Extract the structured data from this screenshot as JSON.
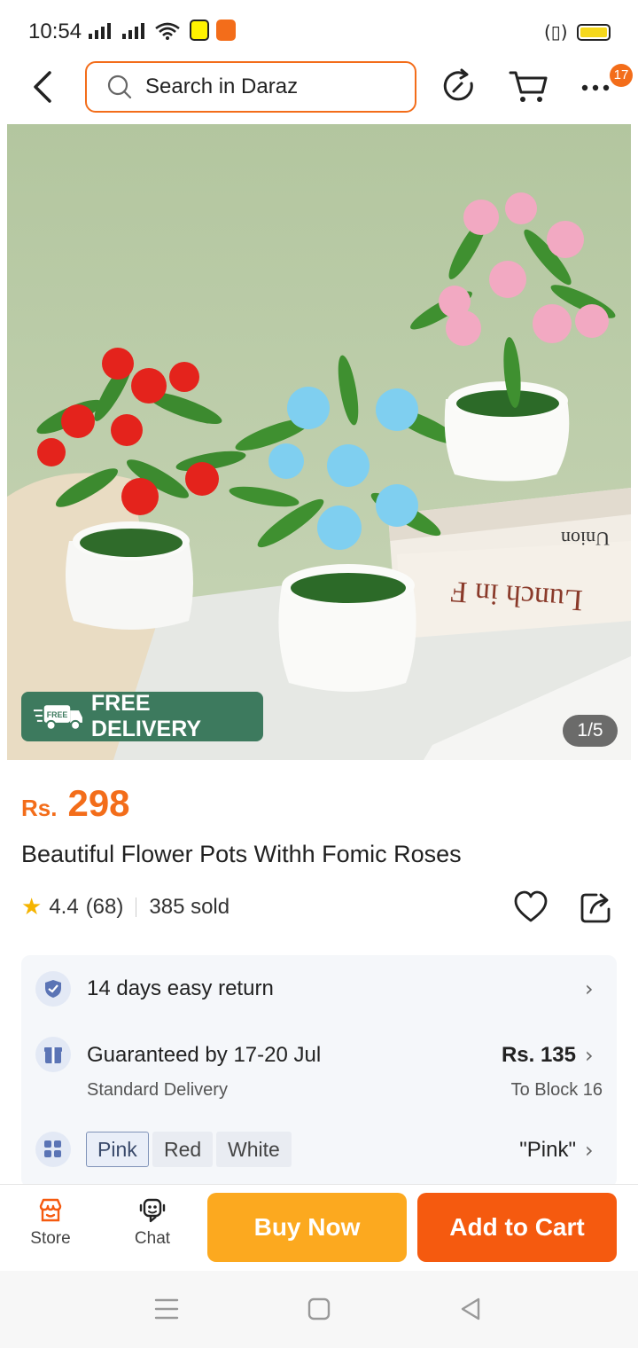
{
  "status_bar": {
    "time": "10:54"
  },
  "header": {
    "search_placeholder": "Search in Daraz",
    "more_badge_count": "17",
    "icons": [
      "back-arrow-icon",
      "search-icon",
      "share-refresh-icon",
      "cart-icon",
      "more-icon"
    ]
  },
  "hero": {
    "free_delivery_label": "FREE DELIVERY",
    "free_tag": "FREE",
    "image_counter": "1/5",
    "book_spine_1": "Lunch in F",
    "book_spine_2": "Union"
  },
  "product": {
    "currency": "Rs.",
    "price": "298",
    "title": "Beautiful Flower Pots Withh Fomic Roses",
    "rating": "4.4",
    "rating_count": "(68)",
    "sold": "385 sold"
  },
  "info": {
    "return_text": "14 days easy return",
    "delivery_text": "Guaranteed by 17-20 Jul",
    "delivery_sub": "Standard Delivery",
    "delivery_price": "Rs. 135",
    "delivery_location": "To Block 16",
    "variants": [
      "Pink",
      "Red",
      "White"
    ],
    "selected_variant": "\"Pink\""
  },
  "bottom_bar": {
    "store_label": "Store",
    "chat_label": "Chat",
    "buy_now_label": "Buy Now",
    "add_to_cart_label": "Add to Cart"
  },
  "colors": {
    "accent": "#f36d1a",
    "buy_now": "#fca91f",
    "add_to_cart": "#f55a0f",
    "free_delivery_bg": "#3d7a5e",
    "star": "#f5b400"
  }
}
